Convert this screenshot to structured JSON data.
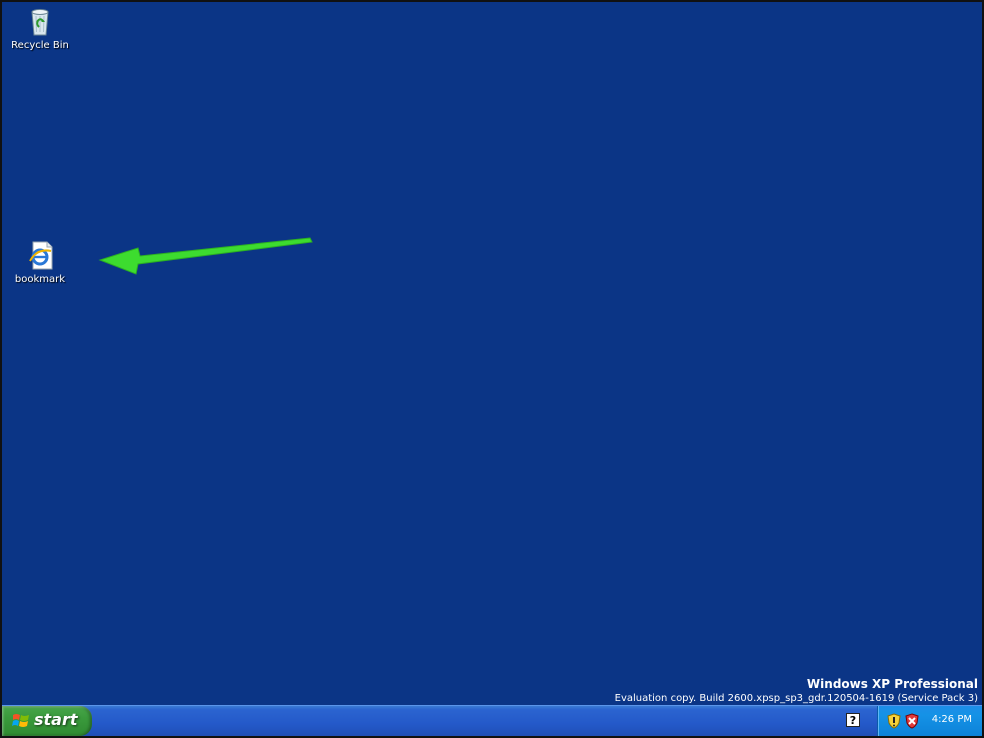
{
  "desktop": {
    "icons": [
      {
        "label": "Recycle Bin",
        "icon": "recycle-bin-icon"
      },
      {
        "label": "bookmark",
        "icon": "internet-explorer-icon"
      }
    ],
    "annotation": {
      "icon": "green-arrow-icon",
      "color": "#3ddc2f"
    }
  },
  "watermark": {
    "title": "Windows XP Professional",
    "subtitle": "Evaluation copy. Build 2600.xpsp_sp3_gdr.120504-1619 (Service Pack 3)"
  },
  "taskbar": {
    "start_label": "start",
    "help_glyph": "?",
    "tray": {
      "icons": [
        "security-shield-icon",
        "security-alert-icon"
      ],
      "clock": "4:26 PM"
    }
  },
  "colors": {
    "desktop_background": "#0b3586",
    "taskbar": "#2459c9",
    "start_button": "#3a9a3c",
    "tray": "#1592e6"
  }
}
